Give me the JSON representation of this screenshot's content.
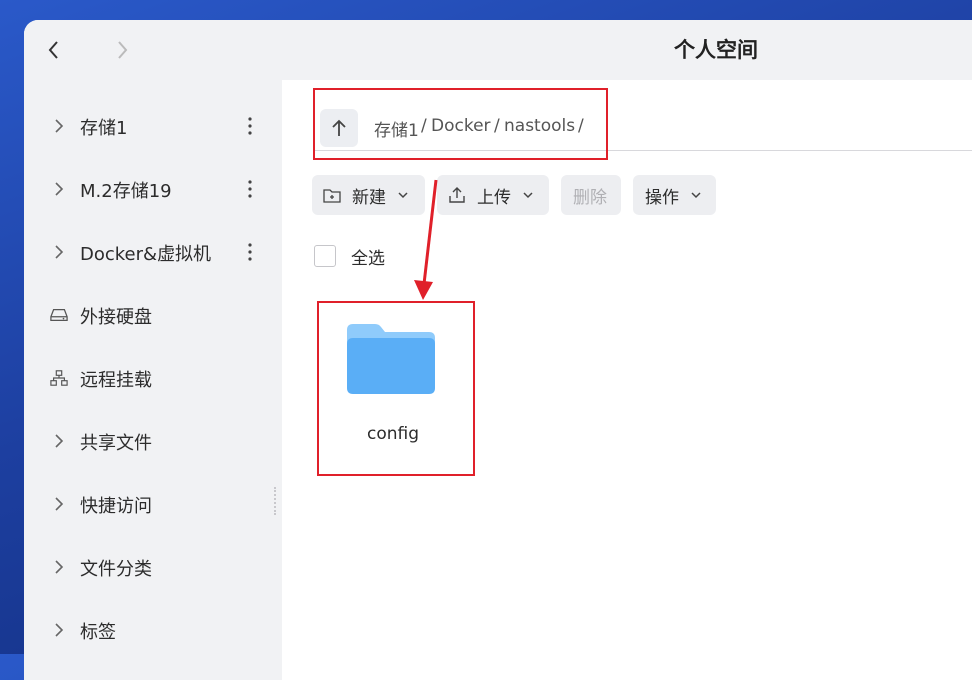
{
  "window": {
    "title": "个人空间"
  },
  "nav": {
    "back_icon": "chevron-left-icon",
    "forward_icon": "chevron-right-icon"
  },
  "sidebar": {
    "items": [
      {
        "label": "存储1",
        "icon": "chevron-right-icon",
        "has_more": true
      },
      {
        "label": "M.2存储19",
        "icon": "chevron-right-icon",
        "has_more": true
      },
      {
        "label": "Docker&虚拟机",
        "icon": "chevron-right-icon",
        "has_more": true
      },
      {
        "label": "外接硬盘",
        "icon": "external-drive-icon",
        "has_more": false
      },
      {
        "label": "远程挂载",
        "icon": "network-icon",
        "has_more": false
      },
      {
        "label": "共享文件",
        "icon": "chevron-right-icon",
        "has_more": false
      },
      {
        "label": "快捷访问",
        "icon": "chevron-right-icon",
        "has_more": false
      },
      {
        "label": "文件分类",
        "icon": "chevron-right-icon",
        "has_more": false
      },
      {
        "label": "标签",
        "icon": "chevron-right-icon",
        "has_more": false
      }
    ]
  },
  "path": {
    "up_icon": "arrow-up-icon",
    "segments": [
      "存储1",
      "Docker",
      "nastools"
    ],
    "separator": "/"
  },
  "toolbar": {
    "new_label": "新建",
    "upload_label": "上传",
    "delete_label": "删除",
    "actions_label": "操作"
  },
  "select_all_label": "全选",
  "files": [
    {
      "name": "config",
      "type": "folder"
    }
  ],
  "colors": {
    "annotation_red": "#e0202a",
    "folder_blue": "#5aaef6"
  }
}
